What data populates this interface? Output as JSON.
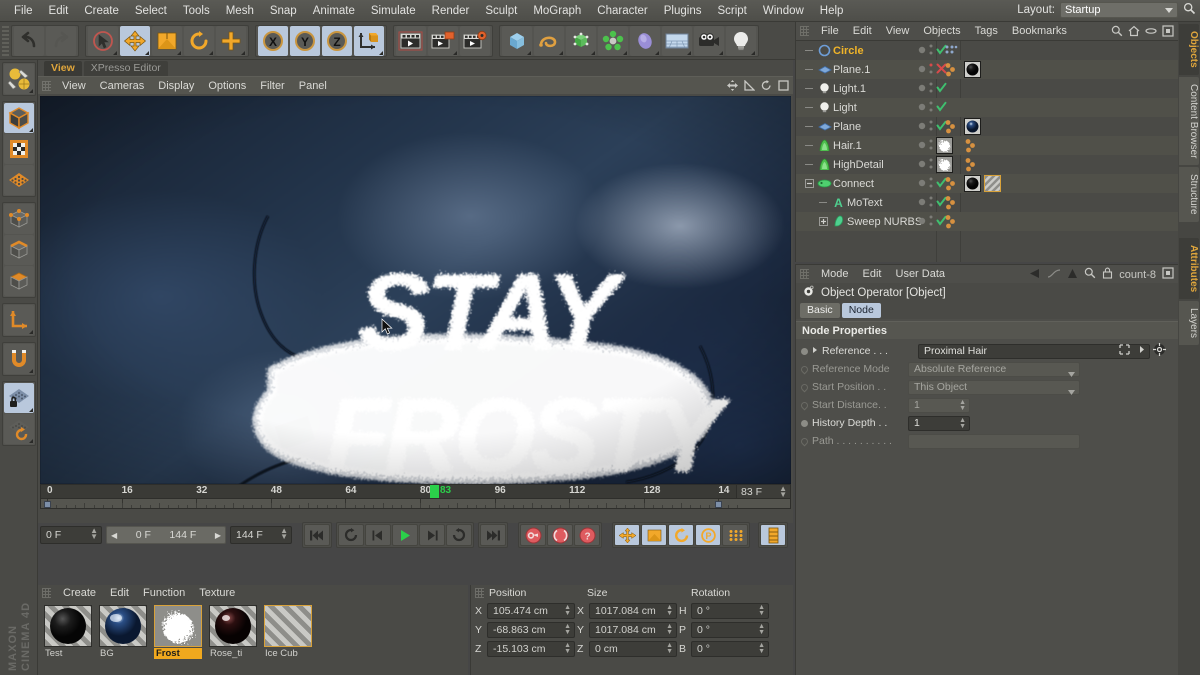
{
  "app": {
    "name": "CINEMA 4D",
    "vendor": "MAXON"
  },
  "menubar": {
    "items": [
      "File",
      "Edit",
      "Create",
      "Select",
      "Tools",
      "Mesh",
      "Snap",
      "Animate",
      "Simulate",
      "Render",
      "Sculpt",
      "MoGraph",
      "Character",
      "Plugins",
      "Script",
      "Window",
      "Help"
    ],
    "layout_label": "Layout:",
    "layout_value": "Startup",
    "search_icon": "search-icon"
  },
  "toolbar": {
    "groups": [
      {
        "name": "history",
        "buttons": [
          {
            "icon": "undo-icon",
            "label": "Undo",
            "active": false
          },
          {
            "icon": "redo-icon",
            "label": "Redo",
            "active": false
          }
        ]
      },
      {
        "name": "transform",
        "buttons": [
          {
            "icon": "live-selection-icon",
            "label": "Live Selection",
            "active": false
          },
          {
            "icon": "move-icon",
            "label": "Move",
            "active": true
          },
          {
            "icon": "scale-icon",
            "label": "Scale",
            "active": false
          },
          {
            "icon": "rotate-icon",
            "label": "Rotate",
            "active": false
          },
          {
            "icon": "plus-icon",
            "label": "Add",
            "active": false
          }
        ]
      },
      {
        "name": "axis-locks",
        "buttons": [
          {
            "icon": "x-axis-icon",
            "label": "X",
            "active": true
          },
          {
            "icon": "y-axis-icon",
            "label": "Y",
            "active": true
          },
          {
            "icon": "z-axis-icon",
            "label": "Z",
            "active": true
          },
          {
            "icon": "world-coordinates-icon",
            "label": "World / Object",
            "active": false
          }
        ]
      },
      {
        "name": "render",
        "buttons": [
          {
            "icon": "render-view-icon",
            "label": "Render View",
            "active": false
          },
          {
            "icon": "render-picture-viewer-icon",
            "label": "Render to Picture Viewer",
            "active": false
          },
          {
            "icon": "render-settings-icon",
            "label": "Edit Render Settings",
            "active": false
          }
        ]
      },
      {
        "name": "create",
        "buttons": [
          {
            "icon": "cube-primitive-icon",
            "label": "Cube",
            "active": false
          },
          {
            "icon": "spline-icon",
            "label": "Spline",
            "active": false
          },
          {
            "icon": "deformer-icon",
            "label": "Bend",
            "active": false
          },
          {
            "icon": "mograph-icon",
            "label": "MoGraph",
            "active": false
          },
          {
            "icon": "generator-icon",
            "label": "Subdivision Surface",
            "active": false
          },
          {
            "icon": "scene-floor-icon",
            "label": "Floor",
            "active": false
          },
          {
            "icon": "camera-icon",
            "label": "Camera",
            "active": false
          },
          {
            "icon": "light-icon",
            "label": "Light",
            "active": false
          }
        ]
      }
    ]
  },
  "left_toolbar": {
    "groups": [
      [
        {
          "icon": "selection-tools-icon",
          "label": "Selection",
          "active": false
        }
      ],
      [
        {
          "icon": "model-mode-icon",
          "label": "Model Mode",
          "active": true
        },
        {
          "icon": "texture-mode-icon",
          "label": "Texture Mode",
          "active": false
        },
        {
          "icon": "workplane-mode-icon",
          "label": "Workplane Mode",
          "active": false
        }
      ],
      [
        {
          "icon": "points-mode-icon",
          "label": "Points",
          "active": false
        },
        {
          "icon": "edges-mode-icon",
          "label": "Edges",
          "active": false
        },
        {
          "icon": "polygons-mode-icon",
          "label": "Polygons",
          "active": false
        }
      ],
      [
        {
          "icon": "axis-mode-icon",
          "label": "Enable Axis",
          "active": false
        }
      ],
      [
        {
          "icon": "snap-magnet-icon",
          "label": "Enable Snap",
          "active": false
        }
      ],
      [
        {
          "icon": "workplane-lock-icon",
          "label": "Lock Workplane",
          "active": true
        },
        {
          "icon": "workplane-rotate-icon",
          "label": "Planar Workplane",
          "active": false
        }
      ]
    ]
  },
  "viewport": {
    "tabs": [
      {
        "label": "View",
        "active": true
      },
      {
        "label": "XPresso Editor",
        "active": false
      }
    ],
    "menu": [
      "View",
      "Cameras",
      "Display",
      "Options",
      "Filter",
      "Panel"
    ],
    "header_icons": [
      "move-view-icon",
      "scale-view-icon",
      "rotate-view-icon",
      "maximize-view-icon"
    ],
    "scene_text_line1": "STAY",
    "scene_text_line2": "FROSTY",
    "cursor_icon": "mouse-pointer-icon"
  },
  "timeline": {
    "ticks": [
      "0",
      "16",
      "32",
      "48",
      "64",
      "80",
      "96",
      "112",
      "128",
      "14"
    ],
    "playhead_label": "83",
    "current_frame_field": "83 F",
    "start_frame_field": "0 F",
    "preview_start": "0 F",
    "preview_end": "144 F",
    "end_frame_field": "144 F",
    "transport": [
      {
        "icon": "go-to-start-icon",
        "label": "Go to Start"
      },
      {
        "icon": "loop-icon",
        "label": "Loop"
      },
      {
        "icon": "step-back-icon",
        "label": "Previous Frame"
      },
      {
        "icon": "play-icon",
        "label": "Play Forward"
      },
      {
        "icon": "step-forward-icon",
        "label": "Next Frame"
      },
      {
        "icon": "play-reverse-icon",
        "label": "Play Reverse"
      },
      {
        "icon": "go-to-end-icon",
        "label": "Go to End"
      }
    ],
    "keyframe_tools": [
      {
        "icon": "record-key-icon",
        "label": "Record Active Objects"
      },
      {
        "icon": "autokey-icon",
        "label": "Autokeying"
      },
      {
        "icon": "keyframe-selection-icon",
        "label": "Keyframe Selection"
      }
    ],
    "key_toggles": [
      {
        "icon": "key-position-icon",
        "label": "Position",
        "active": true
      },
      {
        "icon": "key-scale-icon",
        "label": "Scale",
        "active": true
      },
      {
        "icon": "key-rotation-icon",
        "label": "Rotation",
        "active": true
      },
      {
        "icon": "key-parameter-icon",
        "label": "Parameter",
        "active": true
      },
      {
        "icon": "key-pla-icon",
        "label": "Point Level Animation",
        "active": false
      },
      {
        "icon": "timeline-toggle-icon",
        "label": "Animation Layers",
        "active": true
      }
    ]
  },
  "materials": {
    "menu": [
      "Create",
      "Edit",
      "Function",
      "Texture"
    ],
    "items": [
      {
        "name": "Test",
        "selected": false,
        "swatch": "black-sphere"
      },
      {
        "name": "BG",
        "selected": false,
        "swatch": "blue-sphere"
      },
      {
        "name": "Frost",
        "selected": true,
        "swatch": "white-hair"
      },
      {
        "name": "Rose_ti",
        "selected": false,
        "swatch": "dark-red-sphere"
      },
      {
        "name": "Ice Cub",
        "selected": false,
        "swatch": "striped",
        "bordered": true
      }
    ]
  },
  "coordinates": {
    "headers": [
      "Position",
      "Size",
      "Rotation"
    ],
    "rows": [
      {
        "pos_label": "X",
        "pos_value": "105.474 cm",
        "size_label": "X",
        "size_value": "1017.084 cm",
        "rot_label": "H",
        "rot_value": "0 °"
      },
      {
        "pos_label": "Y",
        "pos_value": "-68.863 cm",
        "size_label": "Y",
        "size_value": "1017.084 cm",
        "rot_label": "P",
        "rot_value": "0 °"
      },
      {
        "pos_label": "Z",
        "pos_value": "-15.103 cm",
        "size_label": "Z",
        "size_value": "0 cm",
        "rot_label": "B",
        "rot_value": "0 °"
      }
    ]
  },
  "object_manager": {
    "menu": [
      "File",
      "Edit",
      "View",
      "Objects",
      "Tags",
      "Bookmarks"
    ],
    "header_icons": [
      "search-icon",
      "home-icon",
      "eye-icon",
      "box-icon"
    ],
    "objects": [
      {
        "label": "Circle",
        "icon": "spline-circle-icon",
        "indent": 0,
        "selected": true,
        "visible_x": false,
        "tags": [
          "mograph-dots-tag"
        ],
        "materials": []
      },
      {
        "label": "Plane.1",
        "icon": "plane-primitive-icon",
        "indent": 0,
        "selected": false,
        "visible_x": true,
        "tags": [
          "dots-tag"
        ],
        "materials": [
          "black-sphere"
        ]
      },
      {
        "label": "Light.1",
        "icon": "light-icon",
        "indent": 0,
        "selected": false,
        "visible_x": false,
        "tags": [],
        "materials": []
      },
      {
        "label": "Light",
        "icon": "light-icon",
        "indent": 0,
        "selected": false,
        "visible_x": false,
        "tags": [],
        "materials": []
      },
      {
        "label": "Plane",
        "icon": "plane-primitive-icon",
        "indent": 0,
        "selected": false,
        "visible_x": false,
        "tags": [
          "dots-tag"
        ],
        "materials": [
          "blue-sphere"
        ]
      },
      {
        "label": "Hair.1",
        "icon": "hair-object-icon",
        "indent": 0,
        "selected": false,
        "visible_x": false,
        "tags": [
          "dots-tag"
        ],
        "materials": [
          "white-hair"
        ]
      },
      {
        "label": "HighDetail",
        "icon": "hair-object-icon",
        "indent": 0,
        "selected": false,
        "visible_x": false,
        "tags": [
          "dots-tag"
        ],
        "materials": [
          "white-hair"
        ]
      },
      {
        "label": "Connect",
        "icon": "connect-object-icon",
        "indent": 0,
        "selected": false,
        "expandable": true,
        "visible_x": false,
        "tags": [
          "dots-tag"
        ],
        "materials": [
          "black-sphere",
          "striped"
        ]
      },
      {
        "label": "MoText",
        "icon": "motext-icon",
        "indent": 1,
        "selected": false,
        "visible_x": false,
        "tags": [
          "dots-tag"
        ],
        "materials": []
      },
      {
        "label": "Sweep NURBS",
        "icon": "sweep-nurbs-icon",
        "indent": 1,
        "selected": false,
        "expandable": true,
        "visible_x": false,
        "tags": [
          "dots-tag"
        ],
        "materials": []
      }
    ]
  },
  "attributes": {
    "menu": [
      "Mode",
      "Edit",
      "User Data"
    ],
    "header_icons": [
      "back-arrow-icon",
      "curve-icon",
      "up-arrow-icon",
      "search-icon",
      "lock-icon",
      "count-8",
      "box-icon"
    ],
    "title": "Object Operator [Object]",
    "title_icon": "gear-icon",
    "tabs": [
      {
        "label": "Basic",
        "active": false
      },
      {
        "label": "Node",
        "active": true
      }
    ],
    "section_title": "Node Properties",
    "properties": [
      {
        "label": "Reference  . . .",
        "value": "Proximal Hair",
        "enabled": true,
        "widget": "link",
        "extra_icons": [
          "expand-icon",
          "chevron-right-icon",
          "target-icon"
        ]
      },
      {
        "label": "Reference Mode",
        "value": "Absolute Reference",
        "enabled": false,
        "widget": "dropdown"
      },
      {
        "label": "Start Position . .",
        "value": "This Object",
        "enabled": false,
        "widget": "dropdown"
      },
      {
        "label": "Start Distance. .",
        "value": "1",
        "enabled": false,
        "widget": "spinner"
      },
      {
        "label": "History Depth . .",
        "value": "1",
        "enabled": true,
        "widget": "spinner"
      },
      {
        "label": "Path . . . . . . . . . .",
        "value": "",
        "enabled": false,
        "widget": "text"
      }
    ]
  },
  "right_tabs": {
    "upper": [
      {
        "label": "Objects",
        "active": true
      },
      {
        "label": "Content Browser",
        "active": false
      },
      {
        "label": "Structure",
        "active": false
      }
    ],
    "lower": [
      {
        "label": "Attributes",
        "active": true
      },
      {
        "label": "Layers",
        "active": false
      }
    ]
  },
  "colors": {
    "accent_orange": "#f0b429",
    "selection_blue": "#b9c8dc",
    "panel_bg": "#4a4a46",
    "play_green": "#2bd14a",
    "record_red": "#e0555a"
  }
}
